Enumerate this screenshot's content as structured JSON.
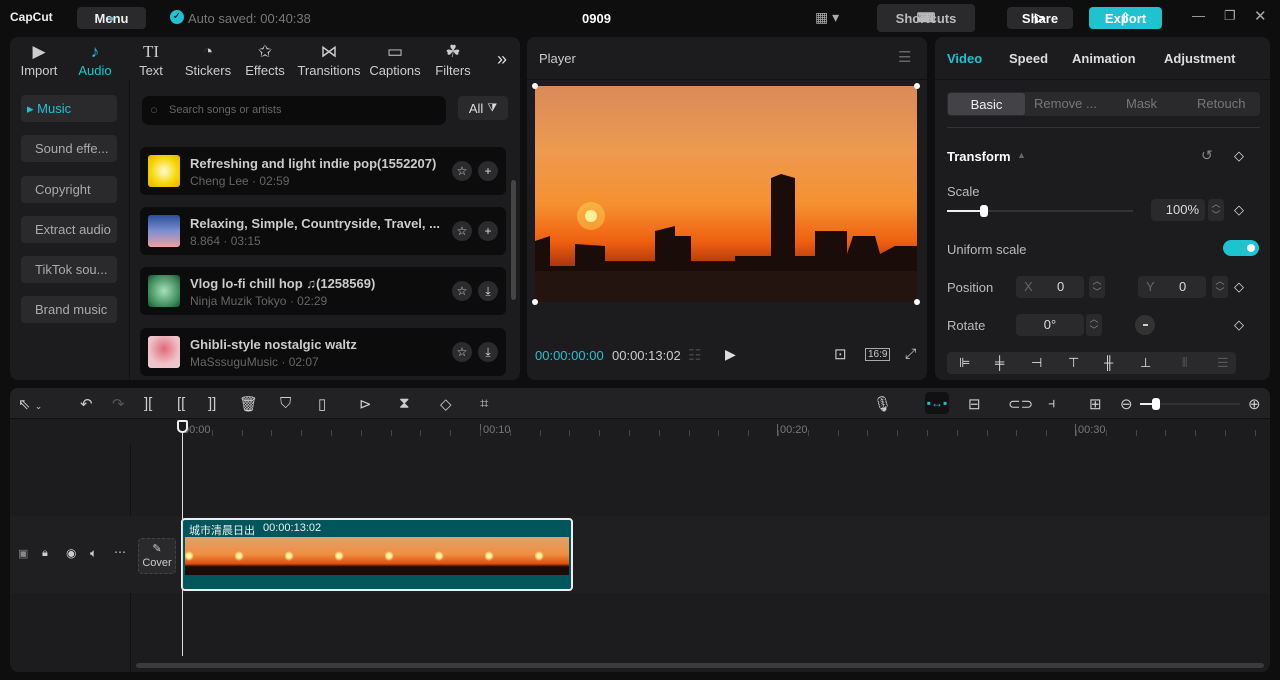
{
  "app": {
    "logo": "CapCut",
    "menu": "Menu",
    "autosave": "Auto saved: 00:40:38",
    "project": "0909",
    "shortcuts": "Shortcuts",
    "share": "Share",
    "export": "Export",
    "accent": "#1fc3d0"
  },
  "tabs": [
    {
      "label": "Import",
      "icon": "▶"
    },
    {
      "label": "Audio",
      "icon": "♪"
    },
    {
      "label": "Text",
      "icon": "TI"
    },
    {
      "label": "Stickers",
      "icon": "◔"
    },
    {
      "label": "Effects",
      "icon": "✩"
    },
    {
      "label": "Transitions",
      "icon": "⋈"
    },
    {
      "label": "Captions",
      "icon": "▭"
    },
    {
      "label": "Filters",
      "icon": "☘"
    }
  ],
  "categories": [
    "Music",
    "Sound effe...",
    "Copyright",
    "Extract audio",
    "TikTok sou...",
    "Brand music"
  ],
  "search": {
    "placeholder": "Search songs or artists",
    "filter": "All"
  },
  "songs": [
    {
      "title": "Refreshing and light indie pop(1552207)",
      "sub": "Cheng Lee · 02:59",
      "action": "+"
    },
    {
      "title": "Relaxing, Simple, Countryside, Travel, ...",
      "sub": "8.864 · 03:15",
      "action": "+"
    },
    {
      "title": "Vlog  lo-fi chill hop ♫(1258569)",
      "sub": "Ninja Muzik Tokyo · 02:29",
      "action": "⤓"
    },
    {
      "title": "Ghibli-style nostalgic waltz",
      "sub": "MaSssuguMusic · 02:07",
      "action": "⤓"
    }
  ],
  "player": {
    "title": "Player",
    "current": "00:00:00:00",
    "total": "00:00:13:02",
    "ratio": "16:9"
  },
  "inspector": {
    "tabs": [
      "Video",
      "Speed",
      "Animation",
      "Adjustment"
    ],
    "subtabs": [
      "Basic",
      "Remove ...",
      "Mask",
      "Retouch"
    ],
    "section": "Transform",
    "scale_label": "Scale",
    "scale": "100%",
    "scale_fraction": 0.2,
    "uniform": "Uniform scale",
    "uniform_on": true,
    "position": "Position",
    "x_label": "X",
    "x": "0",
    "y_label": "Y",
    "y": "0",
    "rotate": "Rotate",
    "rotate_val": "0°"
  },
  "timeline": {
    "ruler": [
      "00:00",
      "00:10",
      "00:20",
      "00:30"
    ],
    "cover": "Cover",
    "clip_name": "城市清晨日出",
    "clip_duration": "00:00:13:02"
  }
}
